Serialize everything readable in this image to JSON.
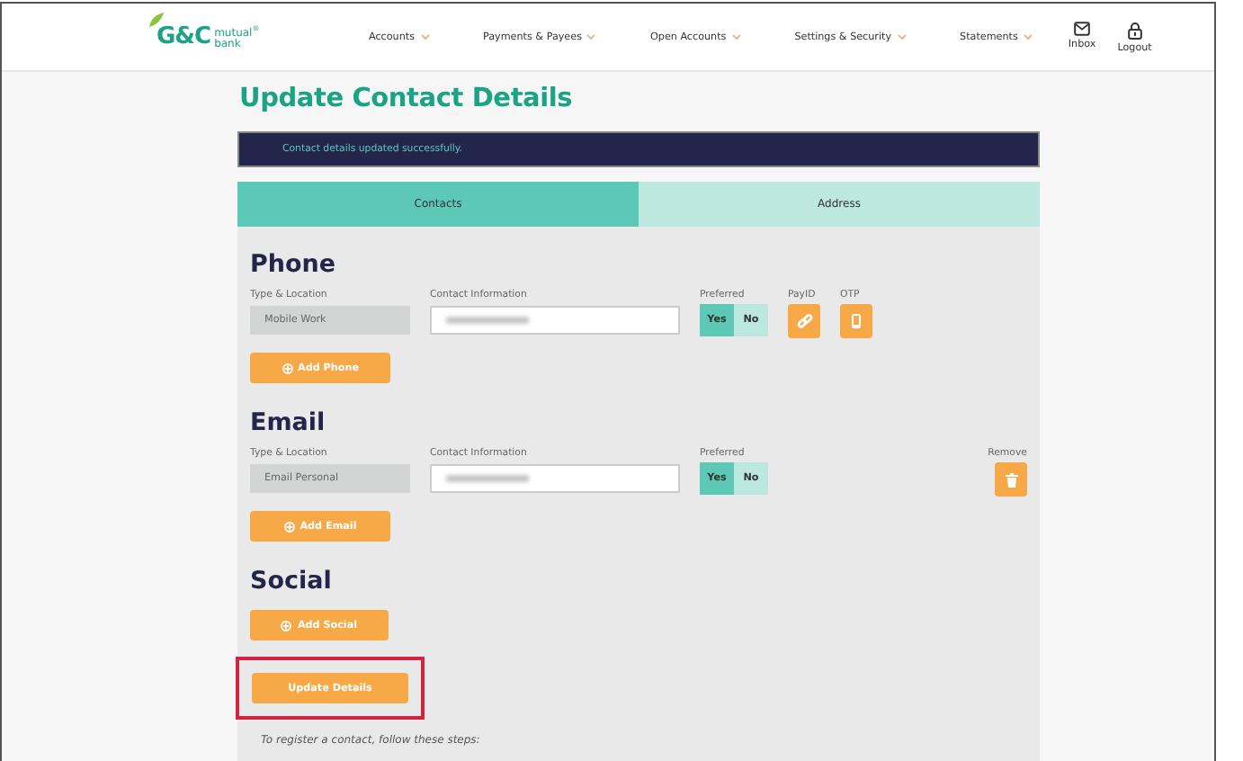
{
  "header": {
    "logo": {
      "mark": "G&C",
      "line1": "mutual",
      "line2": "bank",
      "reg": "®"
    },
    "nav": [
      {
        "label": "Accounts"
      },
      {
        "label": "Payments & Payees"
      },
      {
        "label": "Open Accounts"
      },
      {
        "label": "Settings & Security"
      },
      {
        "label": "Statements"
      }
    ],
    "actions": [
      {
        "label": "Inbox",
        "kind": "mail"
      },
      {
        "label": "Logout",
        "kind": "lock"
      }
    ]
  },
  "title": "Update Contact Details",
  "alert": "Contact details updated successfully.",
  "tabs": [
    {
      "label": "Contacts",
      "selected": true
    },
    {
      "label": "Address",
      "selected": false
    }
  ],
  "sections": [
    {
      "heading": "Phone",
      "rows": [
        {
          "type_label": "Type & Location",
          "type_value": "Mobile Work",
          "contact_label": "Contact Information",
          "preferred_label": "Preferred",
          "options": [
            {
              "label": "Yes",
              "selected": true
            },
            {
              "label": "No",
              "selected": false
            }
          ],
          "extras": [
            {
              "label": "PayID",
              "kind": "link"
            },
            {
              "label": "OTP",
              "kind": "phone"
            }
          ]
        }
      ],
      "add_button": "Add Phone"
    },
    {
      "heading": "Email",
      "rows": [
        {
          "type_label": "Type & Location",
          "type_value": "Email Personal",
          "contact_label": "Contact Information",
          "preferred_label": "Preferred",
          "options": [
            {
              "label": "Yes",
              "selected": true
            },
            {
              "label": "No",
              "selected": false
            }
          ],
          "extras": [
            {
              "label": "Remove",
              "kind": "trash"
            }
          ]
        }
      ],
      "add_button": "Add Email"
    },
    {
      "heading": "Social",
      "add_button": "Add Social"
    }
  ],
  "update_button": {
    "label": "Update Details",
    "highlighted": true
  },
  "footer_text": "To register a contact, follow these steps:"
}
